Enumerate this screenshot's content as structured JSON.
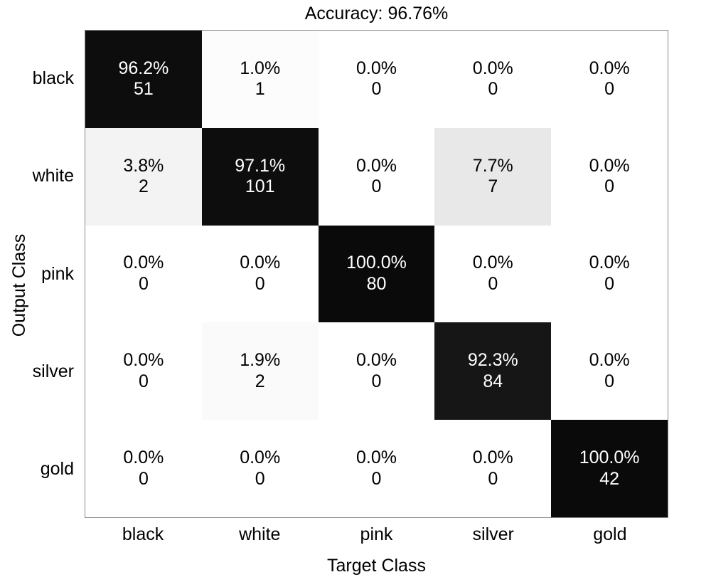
{
  "title": "Accuracy: 96.76%",
  "axes": {
    "ylabel": "Output Class",
    "xlabel": "Target Class",
    "yticks": [
      "black",
      "white",
      "pink",
      "silver",
      "gold"
    ],
    "xticks": [
      "black",
      "white",
      "pink",
      "silver",
      "gold"
    ]
  },
  "colors": {
    "diagonal_dark": "#0d0d0d",
    "diagonal_dark_alt": "#141414",
    "empty": "#ffffff",
    "shade_light": "#f3f3f3",
    "shade_medium": "#e8e8e8",
    "frame": "#888888",
    "text_dark": "#000000",
    "text_light": "#ffffff"
  },
  "chart_data": {
    "type": "heatmap",
    "title": "Accuracy: 96.76%",
    "xlabel": "Target Class",
    "ylabel": "Output Class",
    "accuracy_percent": 96.76,
    "categories": [
      "black",
      "white",
      "pink",
      "silver",
      "gold"
    ],
    "counts": [
      [
        51,
        1,
        0,
        0,
        0
      ],
      [
        2,
        101,
        0,
        7,
        0
      ],
      [
        0,
        0,
        80,
        0,
        0
      ],
      [
        0,
        2,
        0,
        84,
        0
      ],
      [
        0,
        0,
        0,
        0,
        42
      ]
    ],
    "percents": [
      [
        96.2,
        1.0,
        0.0,
        0.0,
        0.0
      ],
      [
        3.8,
        97.1,
        0.0,
        7.7,
        0.0
      ],
      [
        0.0,
        0.0,
        100.0,
        0.0,
        0.0
      ],
      [
        0.0,
        1.9,
        0.0,
        92.3,
        0.0
      ],
      [
        0.0,
        0.0,
        0.0,
        0.0,
        100.0
      ]
    ],
    "legend": "none",
    "grid": false
  },
  "cells": [
    [
      {
        "pct": "96.2%",
        "cnt": "51",
        "bg": "#0d0d0d",
        "fg": "#ffffff"
      },
      {
        "pct": "1.0%",
        "cnt": "1",
        "bg": "#fcfcfc",
        "fg": "#000000"
      },
      {
        "pct": "0.0%",
        "cnt": "0",
        "bg": "#ffffff",
        "fg": "#000000"
      },
      {
        "pct": "0.0%",
        "cnt": "0",
        "bg": "#ffffff",
        "fg": "#000000"
      },
      {
        "pct": "0.0%",
        "cnt": "0",
        "bg": "#ffffff",
        "fg": "#000000"
      }
    ],
    [
      {
        "pct": "3.8%",
        "cnt": "2",
        "bg": "#f3f3f3",
        "fg": "#000000"
      },
      {
        "pct": "97.1%",
        "cnt": "101",
        "bg": "#0d0d0d",
        "fg": "#ffffff"
      },
      {
        "pct": "0.0%",
        "cnt": "0",
        "bg": "#ffffff",
        "fg": "#000000"
      },
      {
        "pct": "7.7%",
        "cnt": "7",
        "bg": "#e8e8e8",
        "fg": "#000000"
      },
      {
        "pct": "0.0%",
        "cnt": "0",
        "bg": "#ffffff",
        "fg": "#000000"
      }
    ],
    [
      {
        "pct": "0.0%",
        "cnt": "0",
        "bg": "#ffffff",
        "fg": "#000000"
      },
      {
        "pct": "0.0%",
        "cnt": "0",
        "bg": "#ffffff",
        "fg": "#000000"
      },
      {
        "pct": "100.0%",
        "cnt": "80",
        "bg": "#0a0a0a",
        "fg": "#ffffff"
      },
      {
        "pct": "0.0%",
        "cnt": "0",
        "bg": "#ffffff",
        "fg": "#000000"
      },
      {
        "pct": "0.0%",
        "cnt": "0",
        "bg": "#ffffff",
        "fg": "#000000"
      }
    ],
    [
      {
        "pct": "0.0%",
        "cnt": "0",
        "bg": "#ffffff",
        "fg": "#000000"
      },
      {
        "pct": "1.9%",
        "cnt": "2",
        "bg": "#fafafa",
        "fg": "#000000"
      },
      {
        "pct": "0.0%",
        "cnt": "0",
        "bg": "#ffffff",
        "fg": "#000000"
      },
      {
        "pct": "92.3%",
        "cnt": "84",
        "bg": "#161616",
        "fg": "#ffffff"
      },
      {
        "pct": "0.0%",
        "cnt": "0",
        "bg": "#ffffff",
        "fg": "#000000"
      }
    ],
    [
      {
        "pct": "0.0%",
        "cnt": "0",
        "bg": "#ffffff",
        "fg": "#000000"
      },
      {
        "pct": "0.0%",
        "cnt": "0",
        "bg": "#ffffff",
        "fg": "#000000"
      },
      {
        "pct": "0.0%",
        "cnt": "0",
        "bg": "#ffffff",
        "fg": "#000000"
      },
      {
        "pct": "0.0%",
        "cnt": "0",
        "bg": "#ffffff",
        "fg": "#000000"
      },
      {
        "pct": "100.0%",
        "cnt": "42",
        "bg": "#0a0a0a",
        "fg": "#ffffff"
      }
    ]
  ]
}
